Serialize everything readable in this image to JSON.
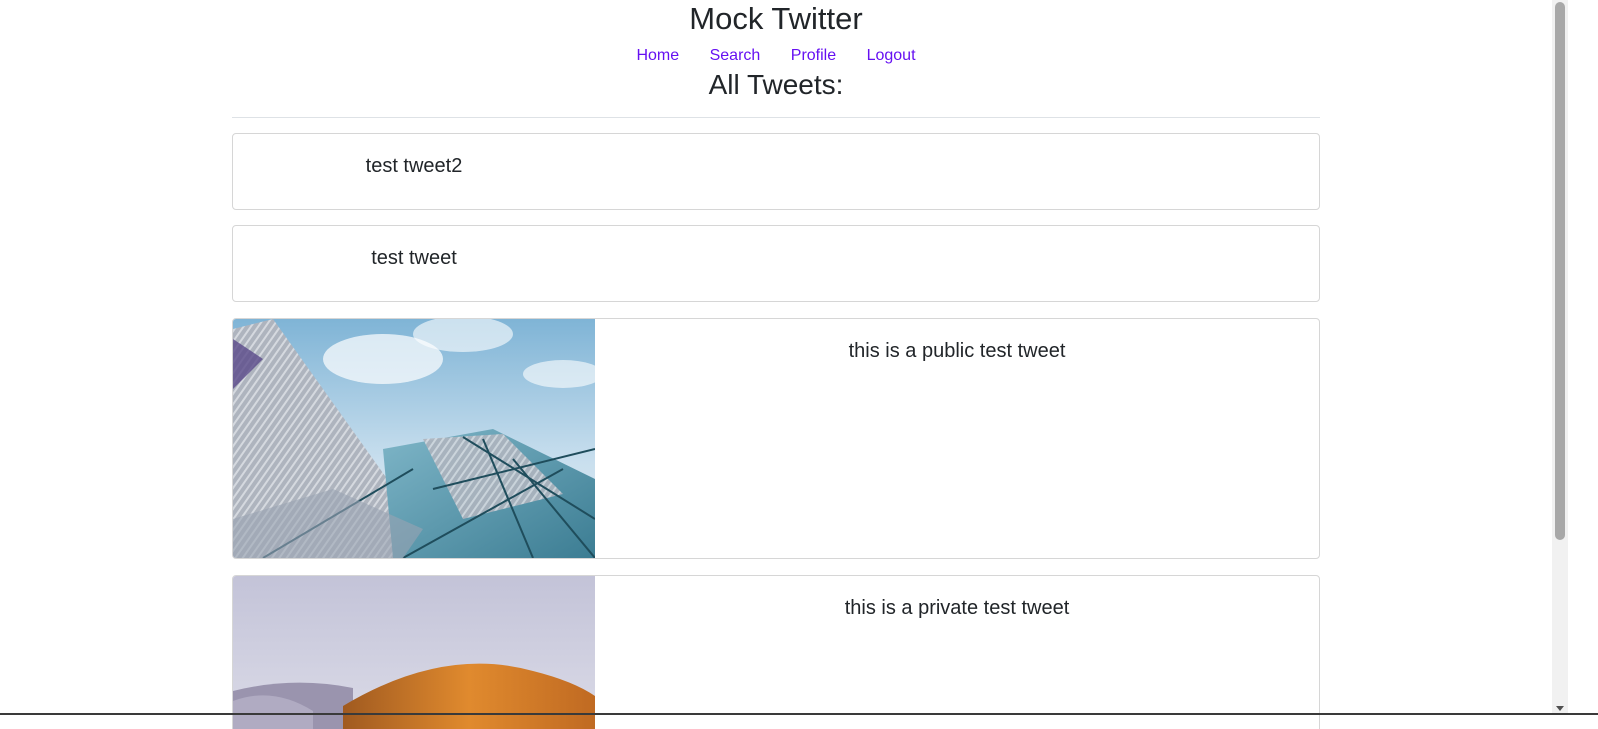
{
  "header": {
    "site_title": "Mock Twitter",
    "nav": [
      "Home",
      "Search",
      "Profile",
      "Logout"
    ],
    "section_title": "All Tweets:"
  },
  "tweets": [
    {
      "text": "test tweet2",
      "has_image": false
    },
    {
      "text": "test tweet",
      "has_image": false
    },
    {
      "text": "this is a public test tweet",
      "has_image": true,
      "image": "glass-building-photo"
    },
    {
      "text": "this is a private test tweet",
      "has_image": true,
      "image": "orange-roof-photo"
    }
  ],
  "colors": {
    "link": "#6610f2",
    "text": "#212529",
    "border": "#d6d6d6"
  }
}
